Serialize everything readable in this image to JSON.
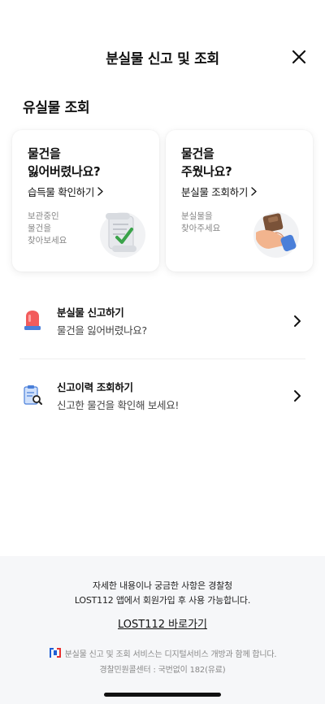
{
  "header": {
    "title": "분실물 신고 및 조회",
    "close_icon": "close-icon"
  },
  "section": {
    "title": "유실물 조회"
  },
  "cards": [
    {
      "question_line1": "물건을",
      "question_line2": "잃어버렸나요?",
      "link_label": "습득물 확인하기",
      "desc_line1": "보관중인",
      "desc_line2": "물건을",
      "desc_line3": "찾아보세요",
      "icon": "scroll-check-icon"
    },
    {
      "question_line1": "물건을",
      "question_line2": "주웠나요?",
      "link_label": "분실물 조회하기",
      "desc_line1": "분실물을",
      "desc_line2": "찾아주세요",
      "icon": "hand-wallet-icon"
    }
  ],
  "list": [
    {
      "title": "분실물 신고하기",
      "subtitle": "물건을 잃어버렸나요?",
      "icon": "siren-icon"
    },
    {
      "title": "신고이력 조회하기",
      "subtitle": "신고한 물건을 확인해 보세요!",
      "icon": "clipboard-search-icon"
    }
  ],
  "footer": {
    "line1": "자세한 내용이나 궁금한 사항은 경찰청",
    "line2": "LOST112 앱에서 회원가입 후 사용 가능합니다.",
    "link_label": "LOST112 바로가기",
    "notice": "분실물 신고 및 조회 서비스는 디지털서비스 개방과 함께 합니다.",
    "contact": "경찰민원콜센터 : 국번없이 182(유료)"
  },
  "colors": {
    "footer_bg": "#f6f7f9",
    "siren_red": "#f25c5c",
    "logo_blue": "#1f5fd6",
    "logo_red": "#e8312f"
  }
}
